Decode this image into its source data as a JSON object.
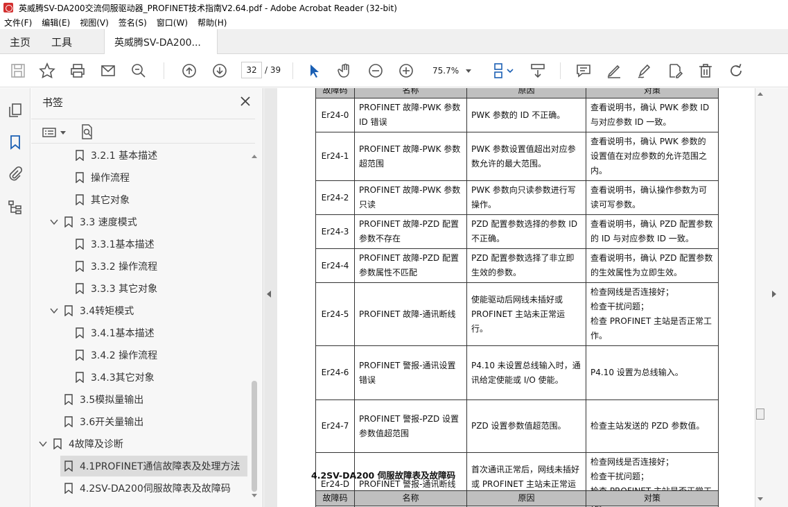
{
  "window": {
    "title": "英威腾SV-DA200交流伺服驱动器_PROFINET技术指南V2.64.pdf - Adobe Acrobat Reader (32-bit)"
  },
  "menu": [
    "文件(F)",
    "编辑(E)",
    "视图(V)",
    "签名(S)",
    "窗口(W)",
    "帮助(H)"
  ],
  "tabs": {
    "home": "主页",
    "tools": "工具",
    "document": "英威腾SV-DA200..."
  },
  "toolbar": {
    "page_current": "32",
    "page_total": "/ 39",
    "zoom": "75.7%"
  },
  "bookmarks": {
    "title": "书签",
    "items": [
      {
        "label": "3.2.1 基本描述"
      },
      {
        "label": "操作流程"
      },
      {
        "label": "其它对象"
      },
      {
        "label": "3.3 速度模式"
      },
      {
        "label": "3.3.1基本描述"
      },
      {
        "label": "3.3.2 操作流程"
      },
      {
        "label": "3.3.3 其它对象"
      },
      {
        "label": "3.4转矩模式"
      },
      {
        "label": "3.4.1基本描述"
      },
      {
        "label": "3.4.2 操作流程"
      },
      {
        "label": "3.4.3其它对象"
      },
      {
        "label": "3.5模拟量输出"
      },
      {
        "label": "3.6开关量输出"
      },
      {
        "label": "4故障及诊断"
      },
      {
        "label": "4.1PROFINET通信故障表及处理方法"
      },
      {
        "label": "4.2SV-DA200伺服故障表及故障码"
      }
    ]
  },
  "document": {
    "table1_header": [
      "故障码",
      "名称",
      "原因",
      "对策"
    ],
    "rows": [
      {
        "code": "Er24-0",
        "name": "PROFINET 故障-PWK 参数 ID 错误",
        "cause": "PWK 参数的 ID 不正确。",
        "action": "查看说明书，确认 PWK 参数 ID 与对应参数 ID 一致。"
      },
      {
        "code": "Er24-1",
        "name": "PROFINET 故障-PWK 参数超范围",
        "cause": "PWK 参数设置值超出对应参数允许的最大范围。",
        "action": "查看说明书，确认 PWK 参数的设置值在对应参数的允许范围之内。"
      },
      {
        "code": "Er24-2",
        "name": "PROFINET 故障-PWK 参数只读",
        "cause": "PWK 参数向只读参数进行写操作。",
        "action": "查看说明书，确认操作参数为可读可写参数。"
      },
      {
        "code": "Er24-3",
        "name": "PROFINET 故障-PZD 配置参数不存在",
        "cause": "PZD 配置参数选择的参数 ID 不正确。",
        "action": "查看说明书，确认 PZD 配置参数的 ID 与对应参数 ID 一致。"
      },
      {
        "code": "Er24-4",
        "name": "PROFINET 故障-PZD 配置参数属性不匹配",
        "cause": "PZD 配置参数选择了非立即生效的参数。",
        "action": "查看说明书，确认 PZD 配置参数的生效属性为立即生效。"
      },
      {
        "code": "Er24-5",
        "name": "PROFINET 故障-通讯断线",
        "cause": "使能驱动后网线未插好或 PROFINET 主站未正常运行。",
        "action": "检查网线是否连接好；\n检查干扰问题；\n检查 PROFINET 主站是否正常工作。"
      },
      {
        "code": "Er24-6",
        "name": "PROFINET 警报-通讯设置错误",
        "cause": "P4.10 未设置总线输入时，通讯给定使能或 I/O 使能。",
        "action": "P4.10 设置为总线输入。"
      },
      {
        "code": "Er24-7",
        "name": "PROFINET 警报-PZD 设置参数值超范围",
        "cause": "PZD 设置参数值超范围。",
        "action": "检查主站发送的 PZD 参数值。"
      },
      {
        "code": "Er24-D",
        "name": "PROFINET 警报-通讯断线",
        "cause": "首次通讯正常后，网线未插好或 PROFINET 主站未正常运行。",
        "action": "检查网线是否连接好；\n检查干扰问题；\n检查 PROFINET 主站是否正常工作。"
      }
    ],
    "section_heading": "4.2SV-DA200 伺服故障表及故障码",
    "table2_header": [
      "故障码",
      "名称",
      "原因",
      "对策"
    ]
  }
}
